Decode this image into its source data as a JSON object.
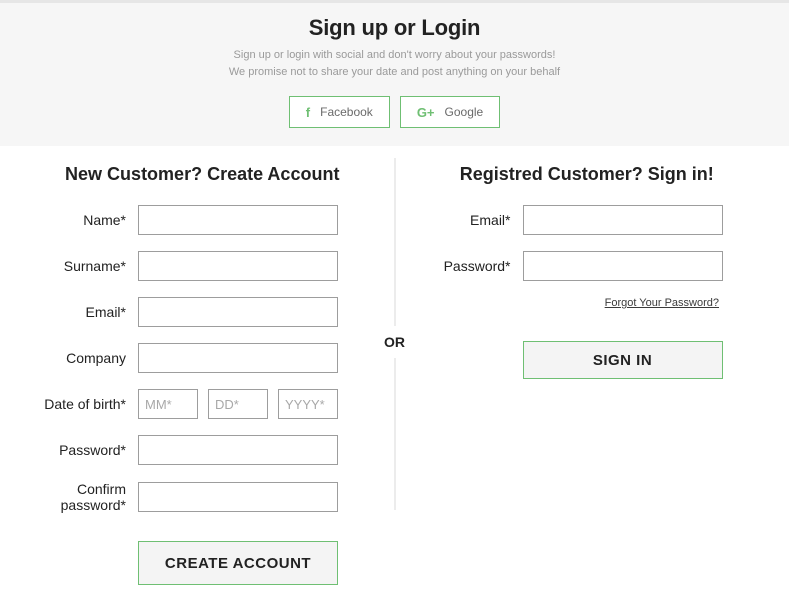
{
  "hero": {
    "title": "Sign up or Login",
    "line1": "Sign up or login with social and don't worry about your passwords!",
    "line2": "We promise not to share your date and post anything on your behalf"
  },
  "social": {
    "facebook": "Facebook",
    "google": "Google"
  },
  "create": {
    "heading": "New Customer? Create Account",
    "name_label": "Name*",
    "surname_label": "Surname*",
    "email_label": "Email*",
    "company_label": "Company",
    "dob_label": "Date of birth*",
    "dob_mm": "MM*",
    "dob_dd": "DD*",
    "dob_yyyy": "YYYY*",
    "password_label": "Password*",
    "confirm_label": "Confirm password*",
    "button": "CREATE ACCOUNT"
  },
  "signin": {
    "heading": "Registred Customer? Sign in!",
    "email_label": "Email*",
    "password_label": "Password*",
    "forgot": "Forgot Your Password?",
    "button": "SIGN IN"
  },
  "divider": {
    "or": "OR"
  }
}
